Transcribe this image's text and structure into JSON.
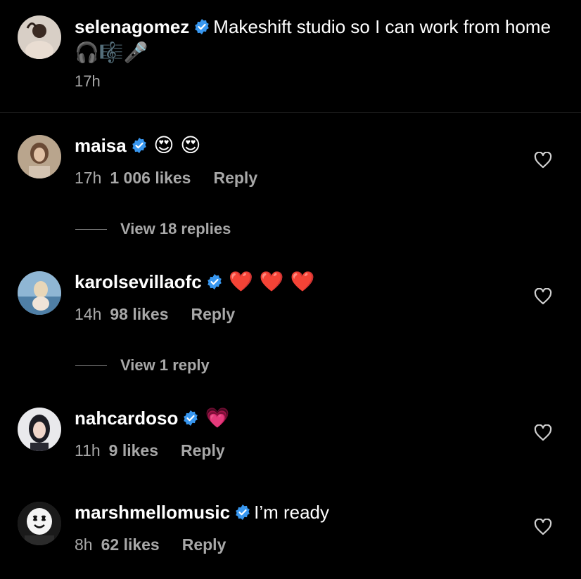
{
  "post": {
    "username": "selenagomez",
    "caption": "Makeshift studio so I can work from home",
    "caption_emojis": "🎧🎼🎤",
    "time": "17h"
  },
  "comments": [
    {
      "username": "maisa",
      "text": "",
      "emojis": "😍 😍",
      "time": "17h",
      "likes": "1 006 likes",
      "reply_label": "Reply",
      "view_replies": "View 18 replies"
    },
    {
      "username": "karolsevillaofc",
      "text": "",
      "emojis": "❤️ ❤️ ❤️",
      "time": "14h",
      "likes": "98 likes",
      "reply_label": "Reply",
      "view_replies": "View 1 reply"
    },
    {
      "username": "nahcardoso",
      "text": "",
      "emojis": "💗",
      "time": "11h",
      "likes": "9 likes",
      "reply_label": "Reply"
    },
    {
      "username": "marshmellomusic",
      "text": "I’m ready",
      "emojis": "",
      "time": "8h",
      "likes": "62 likes",
      "reply_label": "Reply"
    }
  ],
  "colors": {
    "background": "#000000",
    "verified": "#3897f0",
    "secondary_text": "#a8a8a8",
    "emoji_heart": "#e0245e"
  }
}
